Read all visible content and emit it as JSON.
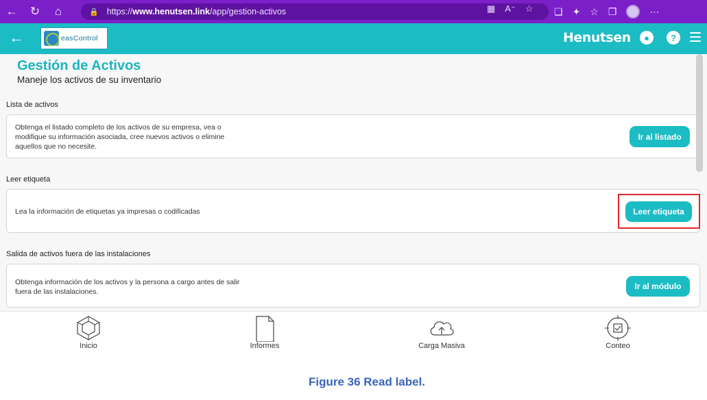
{
  "browser": {
    "url_prefix": "https://",
    "url_host": "www.henutsen.link",
    "url_path": "/app/gestion-activos"
  },
  "header": {
    "logo_text": "easControl",
    "brand": "Henutsen",
    "user_icon": "user-circle-icon",
    "help_icon": "help-circle-icon",
    "menu_icon": "hamburger-menu-icon"
  },
  "page": {
    "title": "Gestión de Activos",
    "subtitle": "Maneje los activos de su inventario"
  },
  "sections": [
    {
      "label": "Lista de activos",
      "description": "Obtenga el listado completo de los activos de su empresa, vea o modifique su información asociada, cree nuevos activos o elimine aquellos que no necesite.",
      "button": "Ir al listado"
    },
    {
      "label": "Leer etiqueta",
      "description": "Lea la información de etiquetas ya impresas o codificadas",
      "button": "Leer etiqueta"
    },
    {
      "label": "Salida de activos fuera de las instalaciones",
      "description": "Obtenga información de los activos y la persona a cargo antes de salir fuera de las instalaciones.",
      "button": "Ir al módulo"
    }
  ],
  "bottom_nav": [
    {
      "label": "Inicio",
      "icon": "cube-home-icon"
    },
    {
      "label": "Informes",
      "icon": "document-icon"
    },
    {
      "label": "Carga Masiva",
      "icon": "cloud-upload-icon"
    },
    {
      "label": "Conteo",
      "icon": "target-check-icon"
    }
  ],
  "caption": "Figure 36 Read label.",
  "colors": {
    "browser": "#7b1fc8",
    "accent": "#1cbcc4",
    "highlight": "#e0262b",
    "caption": "#3a64b8"
  }
}
